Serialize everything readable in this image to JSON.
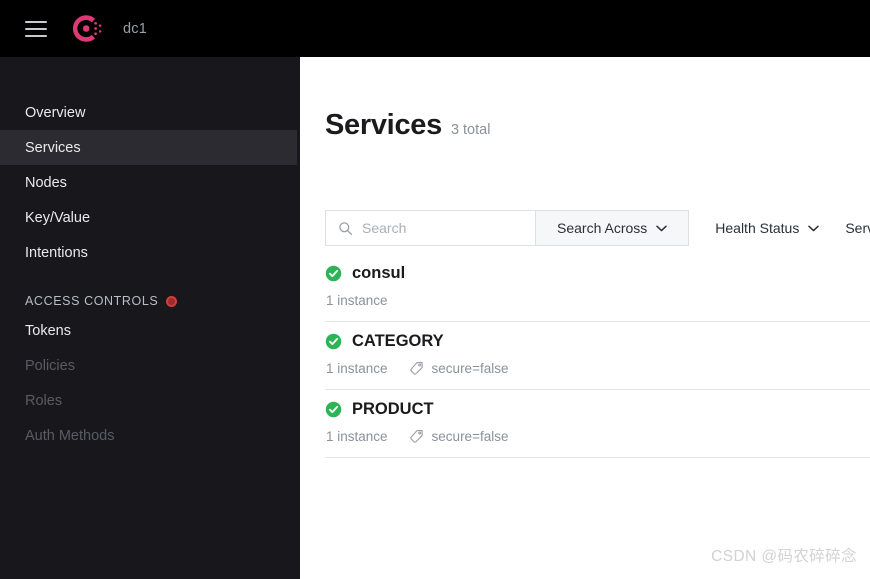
{
  "topbar": {
    "menu_icon": "hamburger-menu-icon",
    "logo_icon": "consul-logo-icon",
    "datacenter": "dc1"
  },
  "sidebar": {
    "items": [
      {
        "label": "Overview",
        "state": "normal"
      },
      {
        "label": "Services",
        "state": "active"
      },
      {
        "label": "Nodes",
        "state": "normal"
      },
      {
        "label": "Key/Value",
        "state": "normal"
      },
      {
        "label": "Intentions",
        "state": "normal"
      }
    ],
    "section": {
      "label": "ACCESS CONTROLS",
      "badge_icon": "record-dot-icon",
      "badge_color": "#d93b3b"
    },
    "acl_items": [
      {
        "label": "Tokens",
        "state": "normal"
      },
      {
        "label": "Policies",
        "state": "disabled"
      },
      {
        "label": "Roles",
        "state": "disabled"
      },
      {
        "label": "Auth Methods",
        "state": "disabled"
      }
    ]
  },
  "page": {
    "title": "Services",
    "count": "3 total"
  },
  "filters": {
    "search": {
      "icon": "search-icon",
      "placeholder": "Search",
      "value": ""
    },
    "search_across": {
      "label": "Search Across",
      "icon": "chevron-down-icon"
    },
    "health_status": {
      "label": "Health Status",
      "icon": "chevron-down-icon"
    },
    "service_type": {
      "label": "Serv",
      "icon": "chevron-down-icon"
    }
  },
  "services": [
    {
      "name": "consul",
      "status_icon": "check-circle-icon",
      "status_color": "#2eb457",
      "instances": "1 instance",
      "tags": []
    },
    {
      "name": "CATEGORY",
      "status_icon": "check-circle-icon",
      "status_color": "#2eb457",
      "instances": "1 instance",
      "tags": [
        {
          "icon": "tag-icon",
          "text": "secure=false"
        }
      ]
    },
    {
      "name": "PRODUCT",
      "status_icon": "check-circle-icon",
      "status_color": "#2eb457",
      "instances": "1 instance",
      "tags": [
        {
          "icon": "tag-icon",
          "text": "secure=false"
        }
      ]
    }
  ],
  "watermark": "CSDN @码农碎碎念"
}
